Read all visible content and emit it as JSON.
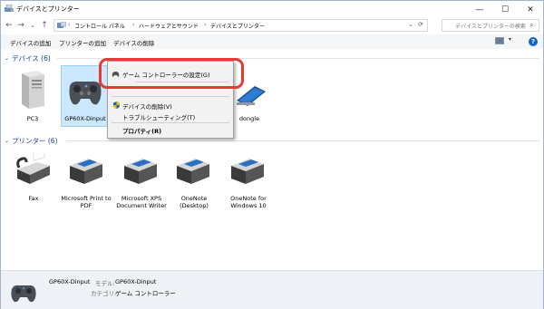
{
  "window": {
    "title": "デバイスとプリンター",
    "controls": [
      "—",
      "☐",
      "✕"
    ]
  },
  "address": {
    "back": "←",
    "forward": "→",
    "history": "⌄",
    "up": "↑",
    "crumbs": [
      "コントロール パネル",
      "ハードウェアとサウンド",
      "デバイスとプリンター"
    ],
    "refresh": "⟳",
    "search_placeholder": "デバイスとプリンターの検索"
  },
  "toolbar": {
    "items": [
      "デバイスの追加",
      "プリンターの追加",
      "デバイスの削除"
    ],
    "help": "?"
  },
  "sections": {
    "devices": "デバイス (6)",
    "printers": "プリンター (6)"
  },
  "devices": [
    {
      "label": "PC3",
      "icon": "pc-tower-icon"
    },
    {
      "label": "GP60X-Dinput",
      "icon": "gamepad-icon",
      "selected": true
    },
    {
      "label": "dongle",
      "icon": "dongle-icon"
    }
  ],
  "printers": [
    {
      "label": "Fax",
      "icon": "fax-icon"
    },
    {
      "label": "Microsoft Print to PDF",
      "icon": "printer-icon"
    },
    {
      "label": "Microsoft XPS Document Writer",
      "icon": "printer-icon"
    },
    {
      "label": "OneNote (Desktop)",
      "icon": "printer-icon"
    },
    {
      "label": "OneNote for Windows 10",
      "icon": "printer-icon"
    }
  ],
  "context_menu": {
    "items": [
      {
        "label": "ゲーム コントローラーの設定(G)",
        "highlighted": true
      },
      {
        "label": "デバイスの削除(V)",
        "shield": true
      },
      {
        "label": "トラブルシューティング(T)"
      },
      {
        "label": "プロパティ(R)",
        "bold": true
      }
    ]
  },
  "status_bar": {
    "device_name": "GP60X-Dinput",
    "model_key": "モデル:",
    "model_value": "GP60X-Dinput",
    "category_key": "カテゴリ:",
    "category_value": "ゲーム コントローラー"
  },
  "colors": {
    "selection": "#cce8ff",
    "highlight_ring": "#e53935",
    "section_header": "#1e3c96"
  }
}
